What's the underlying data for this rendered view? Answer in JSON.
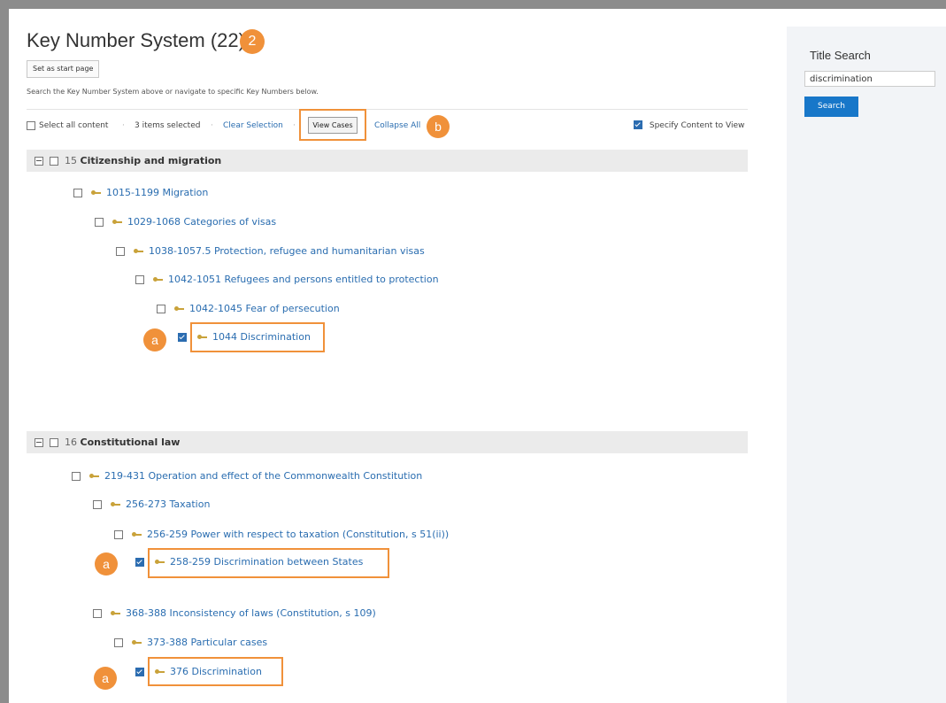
{
  "header": {
    "title": "Key Number System (22)",
    "title_badge": "2",
    "set_start_page": "Set as start page",
    "instructions": "Search the Key Number System above or navigate to specific Key Numbers below."
  },
  "toolbar": {
    "select_all": "Select all content",
    "items_selected": "3 items selected",
    "clear_selection": "Clear Selection",
    "view_cases": "View Cases",
    "collapse_all": "Collapse All",
    "badge_b": "b",
    "specify_content": "Specify Content to View",
    "separator": "·"
  },
  "sidebar": {
    "title": "Title Search",
    "search_value": "discrimination",
    "search_button": "Search"
  },
  "sections": [
    {
      "number": "15",
      "name": "Citizenship and migration",
      "nodes": [
        {
          "number": "1015-1199",
          "name": "Migration",
          "checked": false
        },
        {
          "number": "1029-1068",
          "name": "Categories of visas",
          "checked": false
        },
        {
          "number": "1038-1057.5",
          "name": "Protection, refugee and humanitarian visas",
          "checked": false
        },
        {
          "number": "1042-1051",
          "name": "Refugees and persons entitled to protection",
          "checked": false
        },
        {
          "number": "1042-1045",
          "name": "Fear of persecution",
          "checked": false
        },
        {
          "number": "1044",
          "name": "Discrimination",
          "checked": true
        }
      ]
    },
    {
      "number": "16",
      "name": "Constitutional law",
      "nodes": [
        {
          "number": "219-431",
          "name": "Operation and effect of the Commonwealth Constitution",
          "checked": false
        },
        {
          "number": "256-273",
          "name": "Taxation",
          "checked": false
        },
        {
          "number": "256-259",
          "name": "Power with respect to taxation (Constitution, s 51(ii))",
          "checked": false
        },
        {
          "number": "258-259",
          "name": "Discrimination between States",
          "checked": true
        },
        {
          "number": "368-388",
          "name": "Inconsistency of laws (Constitution, s 109)",
          "checked": false
        },
        {
          "number": "373-388",
          "name": "Particular cases",
          "checked": false
        },
        {
          "number": "376",
          "name": "Discrimination",
          "checked": true
        }
      ]
    }
  ],
  "annotation_label": "a",
  "colors": {
    "accent_orange": "#f0913a",
    "link_blue": "#2a6db0",
    "search_button": "#1877c9",
    "key_gold": "#c9a23a"
  }
}
